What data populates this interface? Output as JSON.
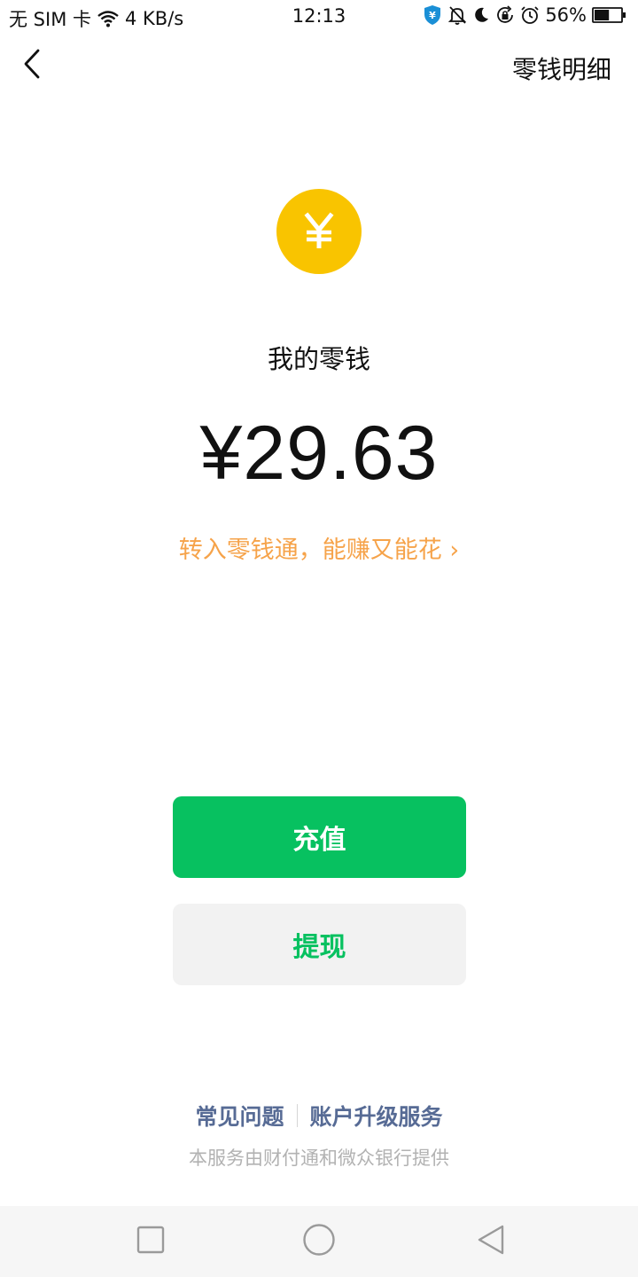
{
  "status_bar": {
    "carrier": "无 SIM 卡",
    "speed": "4 KB/s",
    "time": "12:13",
    "battery": "56%",
    "battery_level": 0.56,
    "icons": [
      "wifi-icon",
      "wallet-shield-icon",
      "bell-muted-icon",
      "moon-icon",
      "rotation-lock-icon",
      "alarm-icon",
      "battery-icon"
    ]
  },
  "header": {
    "back_icon": "chevron-left-icon",
    "details_label": "零钱明细"
  },
  "main": {
    "coin_symbol": "¥",
    "coin_color": "#f9c400",
    "label": "我的零钱",
    "amount": "¥29.63",
    "promo_text": "转入零钱通，能赚又能花 ›",
    "promo_color": "#f6a34a"
  },
  "buttons": {
    "topup_label": "充值",
    "withdraw_label": "提现",
    "accent_color": "#07c160"
  },
  "footer": {
    "faq_label": "常见问题",
    "upgrade_label": "账户升级服务",
    "note": "本服务由财付通和微众银行提供",
    "link_color": "#576b95"
  },
  "nav_bar": {
    "icons": [
      "recent-apps-icon",
      "home-icon",
      "back-triangle-icon"
    ]
  }
}
